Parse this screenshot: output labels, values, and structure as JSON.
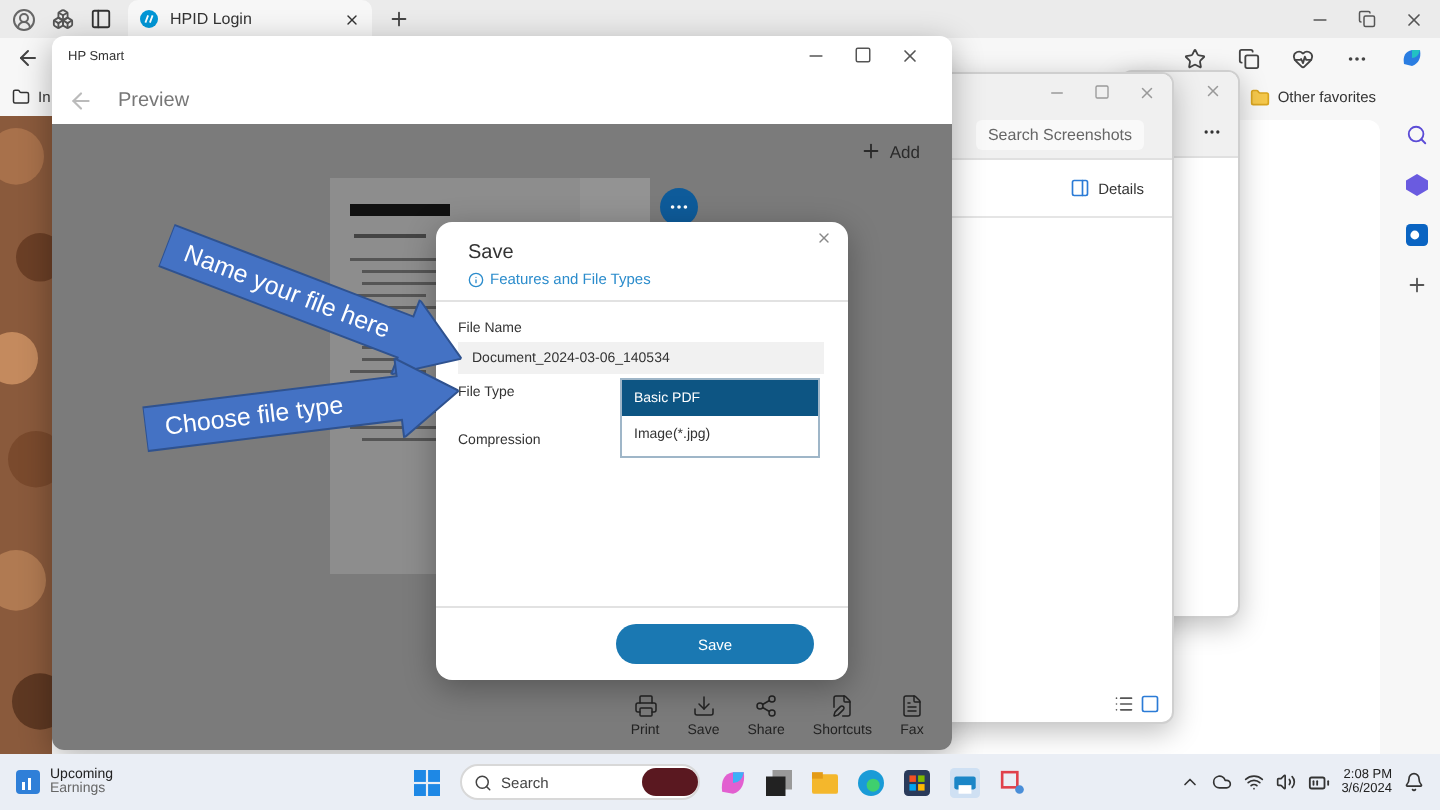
{
  "browser": {
    "tabs": [
      {
        "label": "HPID Login",
        "selected": true
      }
    ],
    "favorites": [
      {
        "label": "In"
      },
      {
        "label": "Other favorites"
      }
    ]
  },
  "hp_window": {
    "title": "HP Smart",
    "header": "Preview",
    "add_label": "Add",
    "toolbar": [
      {
        "kind": "print",
        "label": "Print"
      },
      {
        "kind": "save",
        "label": "Save"
      },
      {
        "kind": "share",
        "label": "Share"
      },
      {
        "kind": "shortcuts",
        "label": "Shortcuts"
      },
      {
        "kind": "fax",
        "label": "Fax"
      }
    ]
  },
  "save_dialog": {
    "title": "Save",
    "info_link": "Features and File Types",
    "file_name": {
      "label": "File Name",
      "value": "Document_2024-03-06_140534"
    },
    "file_type": {
      "label": "File Type",
      "options": [
        {
          "label": "Basic PDF",
          "selected": true
        },
        {
          "label": "Image(*.jpg)",
          "selected": false
        }
      ]
    },
    "compression": {
      "label": "Compression"
    },
    "save_button": "Save"
  },
  "annotations": [
    {
      "text": "Name your file here"
    },
    {
      "text": "Choose file type"
    }
  ],
  "explorer": {
    "search": {
      "placeholder": "Search Screenshots"
    },
    "details_label": "Details"
  },
  "taskbar": {
    "widget": {
      "title": "Upcoming",
      "subtitle": "Earnings"
    },
    "search": {
      "placeholder": "Search"
    },
    "clock": {
      "time": "2:08 PM",
      "date": "3/6/2024"
    }
  }
}
